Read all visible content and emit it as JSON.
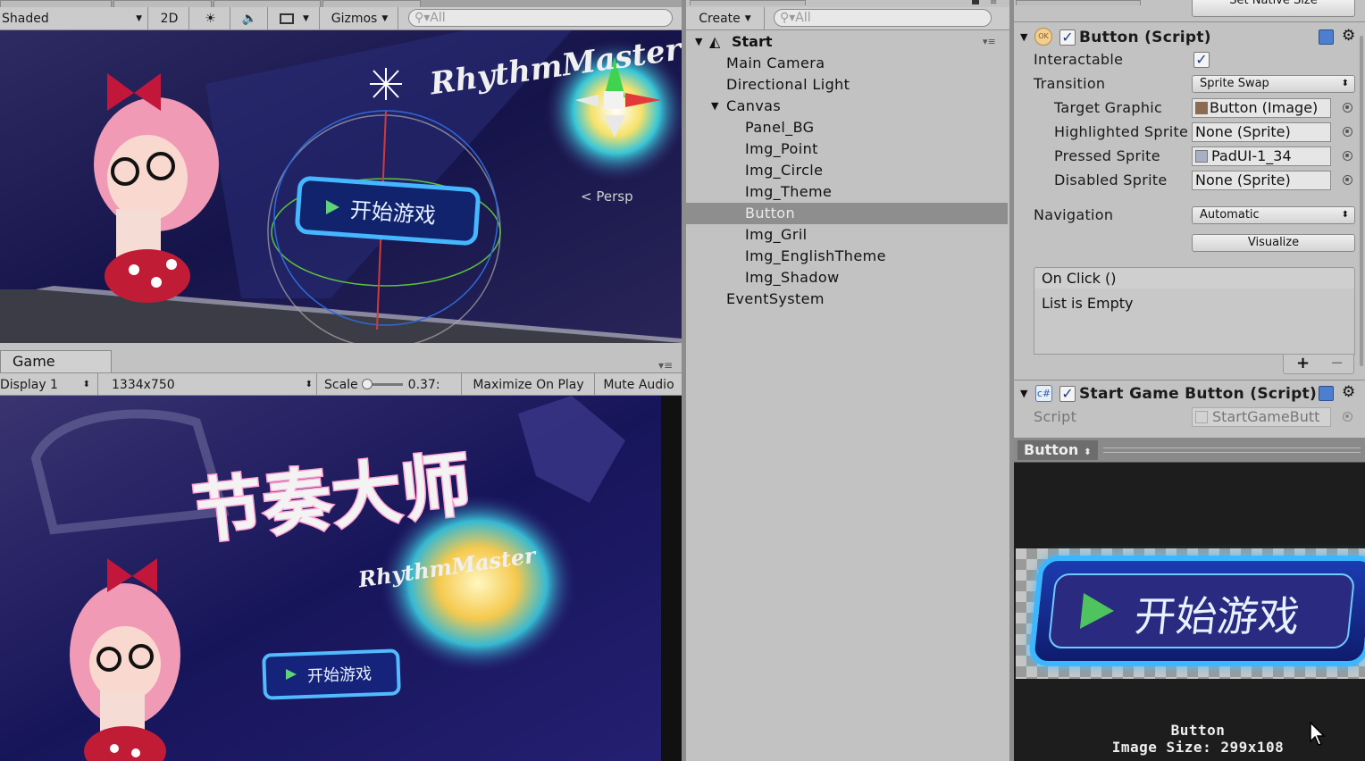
{
  "scene_toolbar": {
    "shading": "Shaded",
    "mode_2d": "2D",
    "gizmos": "Gizmos",
    "search_placeholder": "All",
    "persp_label": "Persp",
    "logo_text": "RhythmMaster",
    "button_text": "开始游戏"
  },
  "game_view": {
    "tab": "Game",
    "display": "Display 1",
    "resolution": "1334x750",
    "scale_label": "Scale",
    "scale_value": "0.37:",
    "maximize": "Maximize On Play",
    "mute": "Mute Audio",
    "title_text": "节奏大师",
    "logo_text": "RhythmMaster",
    "button_text": "开始游戏"
  },
  "hierarchy": {
    "create": "Create",
    "search_placeholder": "All",
    "scene": "Start",
    "items": [
      {
        "label": "Main Camera"
      },
      {
        "label": "Directional Light"
      },
      {
        "label": "Canvas"
      },
      {
        "label": "Panel_BG"
      },
      {
        "label": "Img_Point"
      },
      {
        "label": "Img_Circle"
      },
      {
        "label": "Img_Theme"
      },
      {
        "label": "Button"
      },
      {
        "label": "Img_Gril"
      },
      {
        "label": "Img_EnglishTheme"
      },
      {
        "label": "Img_Shadow"
      },
      {
        "label": "EventSystem"
      }
    ]
  },
  "inspector": {
    "set_native_size": "Set Native Size",
    "button_component": {
      "title": "Button (Script)",
      "interactable_label": "Interactable",
      "transition_label": "Transition",
      "transition_value": "Sprite Swap",
      "target_graphic_label": "Target Graphic",
      "target_graphic_value": "Button (Image)",
      "highlighted_label": "Highlighted Sprite",
      "highlighted_value": "None (Sprite)",
      "pressed_label": "Pressed Sprite",
      "pressed_value": "PadUI-1_34",
      "disabled_label": "Disabled Sprite",
      "disabled_value": "None (Sprite)",
      "navigation_label": "Navigation",
      "navigation_value": "Automatic",
      "visualize": "Visualize",
      "on_click": "On Click ()",
      "list_empty": "List is Empty",
      "plus": "+",
      "minus": "−"
    },
    "script_component": {
      "title": "Start Game Button (Script)",
      "script_label": "Script",
      "script_value": "StartGameButt"
    }
  },
  "preview": {
    "title": "Button",
    "caption_name": "Button",
    "caption_size": "Image Size: 299x108",
    "button_text": "开始游戏"
  },
  "colors": {
    "panel_bg": "#c2c2c2",
    "selection": "#8e8e8e",
    "checkbox": "#1b3c8a"
  }
}
